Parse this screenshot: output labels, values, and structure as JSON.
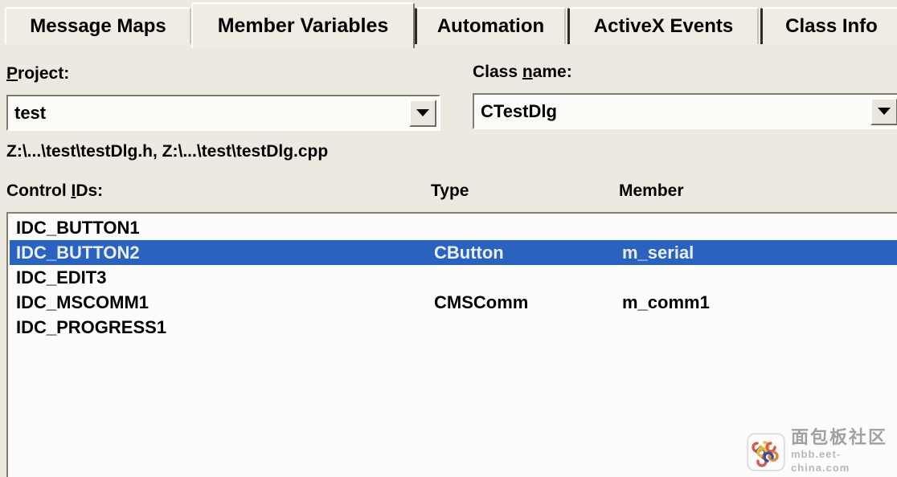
{
  "tabs": [
    {
      "label": "Message Maps",
      "selected": false
    },
    {
      "label": "Member Variables",
      "selected": true
    },
    {
      "label": "Automation",
      "selected": false
    },
    {
      "label": "ActiveX Events",
      "selected": false
    },
    {
      "label": "Class Info",
      "selected": false
    }
  ],
  "fields": {
    "project_label_pre": "",
    "project_label_accel": "P",
    "project_label_post": "roject:",
    "project_label_full": "Project:",
    "project_value": "test",
    "classname_label_pre": "Class ",
    "classname_label_accel": "n",
    "classname_label_post": "ame:",
    "classname_label_full": "Class name:",
    "classname_value": "CTestDlg"
  },
  "file_path": "Z:\\...\\test\\testDlg.h, Z:\\...\\test\\testDlg.cpp",
  "columns": {
    "control_ids_pre": "Control ",
    "control_ids_accel": "I",
    "control_ids_post": "Ds:",
    "control_ids_full": "Control IDs:",
    "type": "Type",
    "member": "Member"
  },
  "rows": [
    {
      "id": "IDC_BUTTON1",
      "type": "",
      "member": "",
      "selected": false
    },
    {
      "id": "IDC_BUTTON2",
      "type": "CButton",
      "member": "m_serial",
      "selected": true
    },
    {
      "id": "IDC_EDIT3",
      "type": "",
      "member": "",
      "selected": false
    },
    {
      "id": "IDC_MSCOMM1",
      "type": "CMSComm",
      "member": "m_comm1",
      "selected": false
    },
    {
      "id": "IDC_PROGRESS1",
      "type": "",
      "member": "",
      "selected": false
    }
  ],
  "watermark": {
    "site_name": "面包板社区",
    "url": "mbb.eet-china.com"
  },
  "colors": {
    "dialog_background": "#ebe9e0",
    "tab_face": "#eeece3",
    "list_background": "#fafafa",
    "selection_blue": "#2a62c0",
    "selection_text": "#e8f0fc",
    "text": "#000000"
  }
}
